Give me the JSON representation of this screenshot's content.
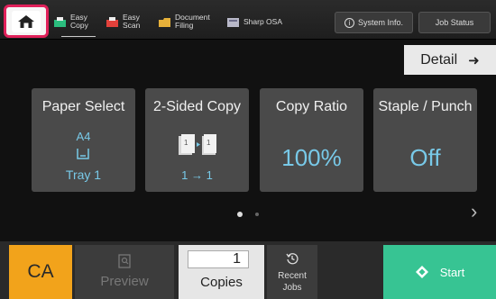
{
  "topbar": {
    "tabs": [
      {
        "label": "Easy Copy",
        "icon": "copy-icon",
        "active": true
      },
      {
        "label": "Easy Scan",
        "icon": "scan-icon",
        "active": false
      },
      {
        "label": "Document Filing",
        "icon": "folder-icon",
        "active": false
      },
      {
        "label": "Sharp OSA",
        "icon": "osa-icon",
        "active": false
      }
    ],
    "system_info_label": "System Info.",
    "job_status_label": "Job Status"
  },
  "detail_label": "Detail",
  "cards": {
    "paper_select": {
      "title": "Paper Select",
      "size": "A4",
      "tray": "Tray 1"
    },
    "two_sided": {
      "title": "2-Sided Copy",
      "mode": "1 → 1"
    },
    "copy_ratio": {
      "title": "Copy Ratio",
      "value": "100%"
    },
    "staple_punch": {
      "title": "Staple / Punch",
      "value": "Off"
    }
  },
  "pager": {
    "current": 1,
    "total": 2
  },
  "bottom": {
    "ca_label": "CA",
    "preview_label": "Preview",
    "copies_value": "1",
    "copies_label": "Copies",
    "recent_label_1": "Recent",
    "recent_label_2": "Jobs",
    "start_label": "Start"
  },
  "colors": {
    "accent_blue": "#78c9e8",
    "ca_orange": "#f2a31b",
    "start_green": "#37c493",
    "home_highlight": "#e0205a"
  }
}
